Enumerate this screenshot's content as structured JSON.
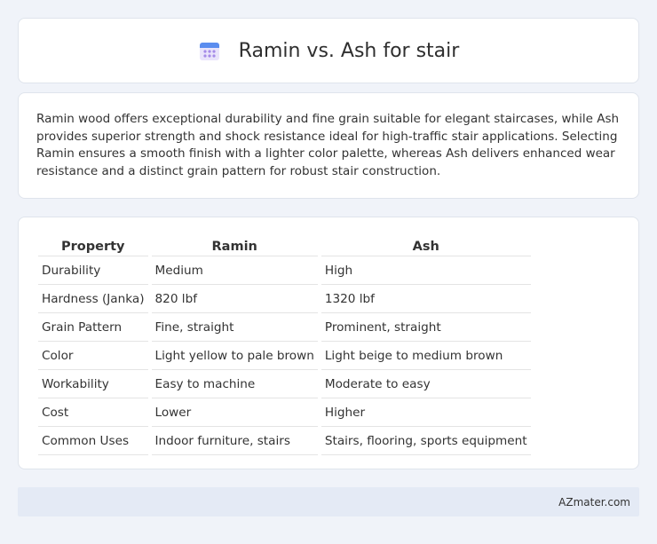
{
  "header": {
    "title": "Ramin vs. Ash for stair",
    "icon": "calendar-icon"
  },
  "description": "Ramin wood offers exceptional durability and fine grain suitable for elegant staircases, while Ash provides superior strength and shock resistance ideal for high-traffic stair applications. Selecting Ramin ensures a smooth finish with a lighter color palette, whereas Ash delivers enhanced wear resistance and a distinct grain pattern for robust stair construction.",
  "table": {
    "headers": [
      "Property",
      "Ramin",
      "Ash"
    ],
    "rows": [
      [
        "Durability",
        "Medium",
        "High"
      ],
      [
        "Hardness (Janka)",
        "820 lbf",
        "1320 lbf"
      ],
      [
        "Grain Pattern",
        "Fine, straight",
        "Prominent, straight"
      ],
      [
        "Color",
        "Light yellow to pale brown",
        "Light beige to medium brown"
      ],
      [
        "Workability",
        "Easy to machine",
        "Moderate to easy"
      ],
      [
        "Cost",
        "Lower",
        "Higher"
      ],
      [
        "Common Uses",
        "Indoor furniture, stairs",
        "Stairs, flooring, sports equipment"
      ]
    ]
  },
  "footer": {
    "brand": "AZmater.com"
  }
}
